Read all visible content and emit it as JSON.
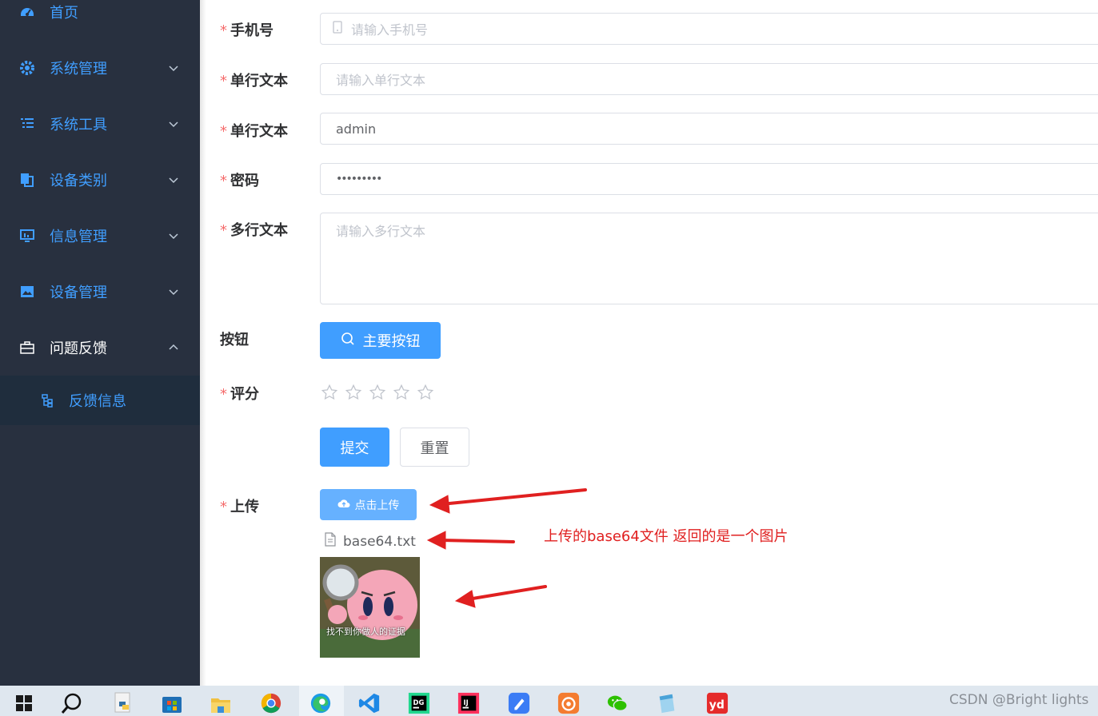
{
  "sidebar": {
    "items": [
      {
        "label": "首页",
        "icon": "dashboard-icon"
      },
      {
        "label": "系统管理",
        "icon": "gear-icon"
      },
      {
        "label": "系统工具",
        "icon": "list-icon"
      },
      {
        "label": "设备类别",
        "icon": "copy-icon"
      },
      {
        "label": "信息管理",
        "icon": "monitor-icon"
      },
      {
        "label": "设备管理",
        "icon": "picture-icon"
      },
      {
        "label": "问题反馈",
        "icon": "briefcase-icon"
      }
    ],
    "sub_item": {
      "label": "反馈信息",
      "icon": "tree-icon"
    }
  },
  "form": {
    "phone": {
      "label": "手机号",
      "placeholder": "请输入手机号"
    },
    "single_text_1": {
      "label": "单行文本",
      "placeholder": "请输入单行文本"
    },
    "single_text_2": {
      "label": "单行文本",
      "value": "admin"
    },
    "password": {
      "label": "密码",
      "value": "•••••••••"
    },
    "multi_text": {
      "label": "多行文本",
      "placeholder": "请输入多行文本"
    },
    "button_row": {
      "label": "按钮",
      "primary_label": "主要按钮"
    },
    "rating": {
      "label": "评分",
      "value": 0,
      "max": 5
    },
    "submit_label": "提交",
    "reset_label": "重置",
    "upload": {
      "label": "上传",
      "button_label": "点击上传",
      "file_name": "base64.txt",
      "preview_caption": "找不到你做人的证据"
    }
  },
  "annotation": {
    "text": "上传的base64文件 返回的是一个图片",
    "color": "#e02020"
  },
  "watermark": "CSDN @Bright lights",
  "colors": {
    "primary": "#409eff",
    "sidebar_bg": "#28303f",
    "required": "#f56c6c"
  }
}
